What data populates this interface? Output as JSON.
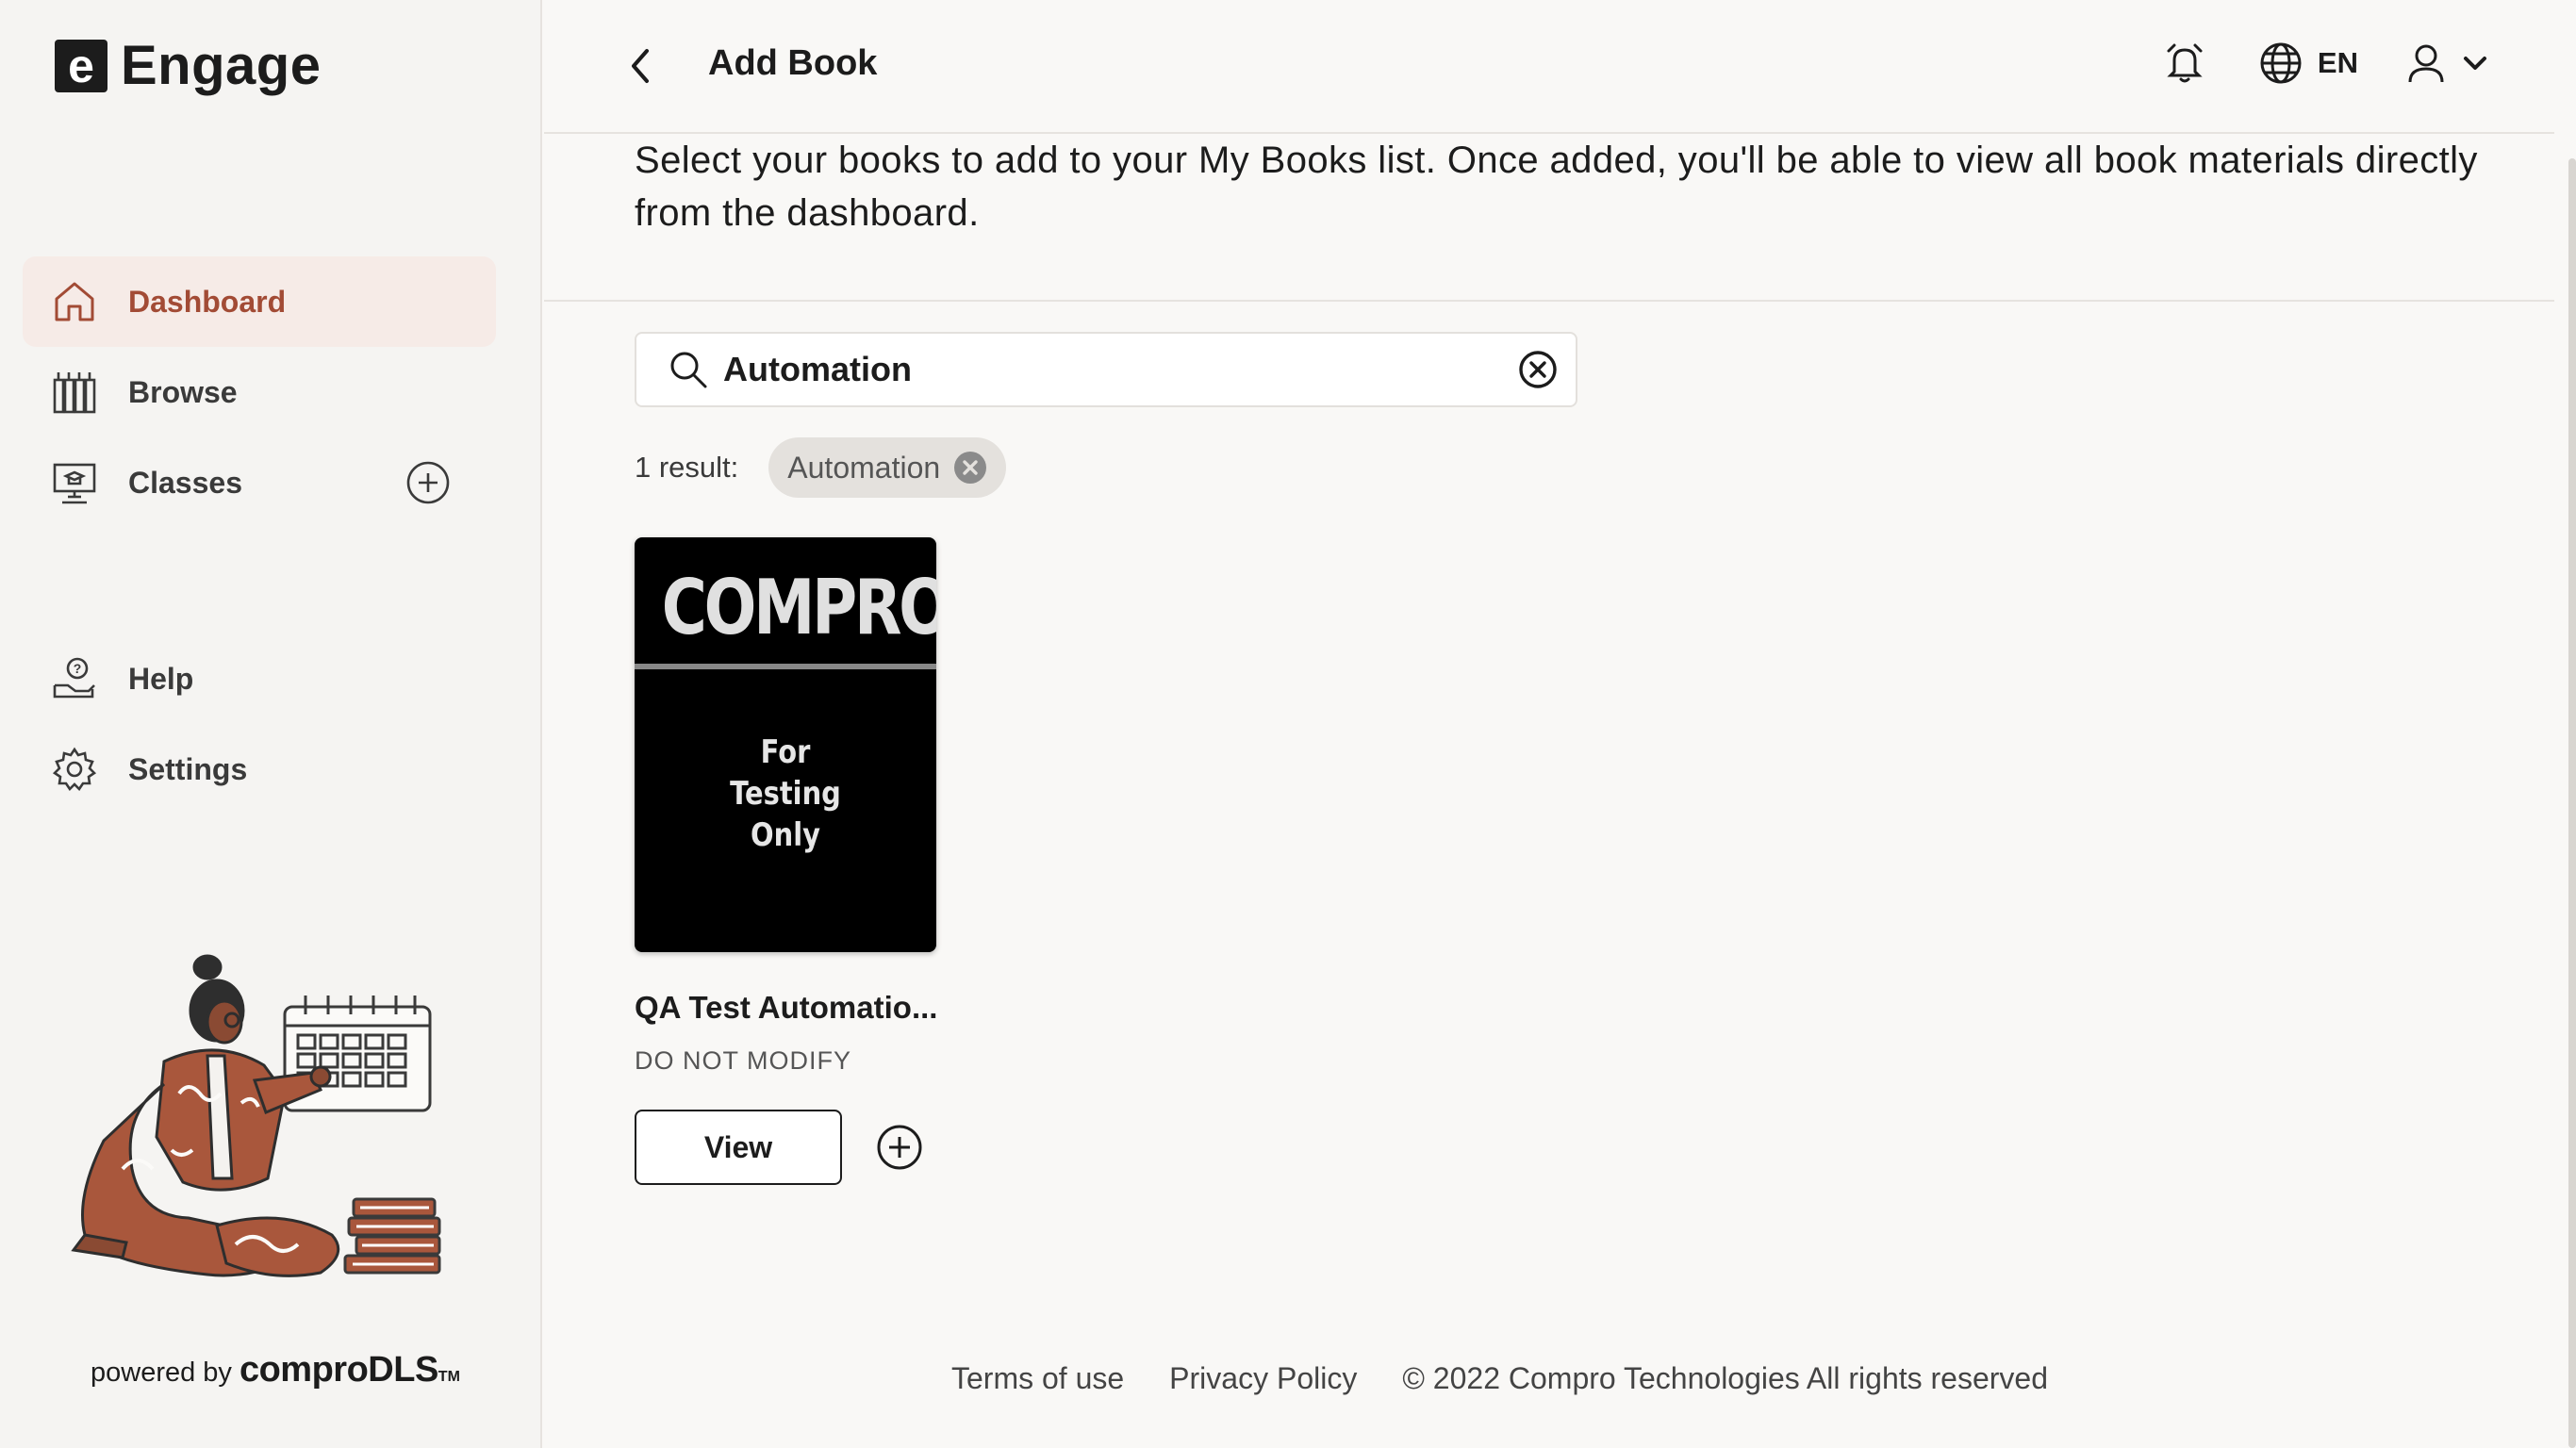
{
  "app": {
    "logo_letter": "e",
    "name": "Engage"
  },
  "sidebar": {
    "items": [
      {
        "label": "Dashboard",
        "icon": "home-icon",
        "active": true
      },
      {
        "label": "Browse",
        "icon": "books-icon"
      },
      {
        "label": "Classes",
        "icon": "classroom-icon"
      },
      {
        "label": "Help",
        "icon": "help-icon"
      },
      {
        "label": "Settings",
        "icon": "gear-icon"
      }
    ],
    "powered_by": "powered by",
    "powered_brand": "comproDLS",
    "powered_tm": "TM"
  },
  "header": {
    "title": "Add Book",
    "language": "EN"
  },
  "intro_text": "Select your books to add to your My Books list. Once added, you'll be able to view all book materials directly from the dashboard.",
  "search": {
    "value": "Automation"
  },
  "results": {
    "count_label": "1 result:",
    "chip": "Automation"
  },
  "book": {
    "cover_brand": "COMPRO",
    "cover_subtitle": "For\nTesting\nOnly",
    "title": "QA Test Automatio...",
    "subtitle": "DO NOT MODIFY",
    "view_label": "View"
  },
  "footer": {
    "terms": "Terms of use",
    "privacy": "Privacy Policy",
    "copyright": "© 2022 Compro Technologies All rights reserved"
  },
  "colors": {
    "accent": "#a24b35",
    "active_bg": "#f6ebe7"
  }
}
